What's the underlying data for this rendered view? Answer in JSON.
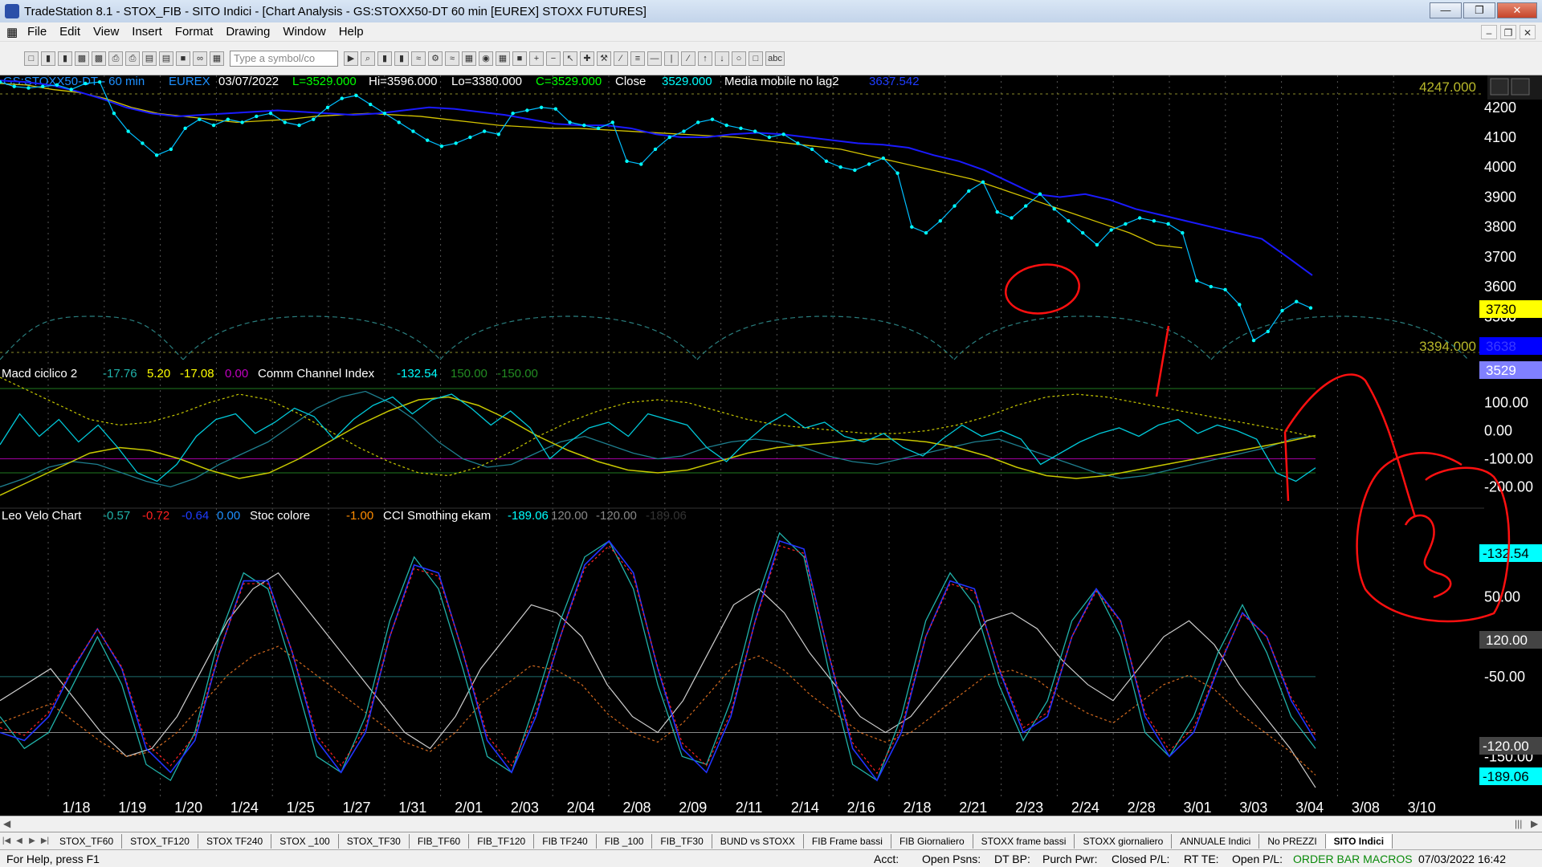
{
  "window": {
    "title": "TradeStation 8.1 - STOX_FIB - SITO Indici - [Chart Analysis - GS:STOXX50-DT  60 min  [EUREX] STOXX FUTURES]"
  },
  "menu": [
    "File",
    "Edit",
    "View",
    "Insert",
    "Format",
    "Drawing",
    "Window",
    "Help"
  ],
  "toolbar": {
    "symbol_placeholder": "Type a symbol/co"
  },
  "chart_header": {
    "symbol": "GS:STOXX50-DT - 60 min",
    "exchange": "EUREX",
    "date": "03/07/2022",
    "last": "L=3529.000",
    "hi": "Hi=3596.000",
    "lo": "Lo=3380.000",
    "close_field": "C=3529.000",
    "close_label": "Close",
    "close_value": "3529.000",
    "ma_label": "Media mobile no lag2",
    "ma_value": "3637.542"
  },
  "panel2_header": {
    "name1": "Macd ciclico 2",
    "v1": "-17.76",
    "v2": "5.20",
    "v3": "-17.08",
    "v4": "0.00",
    "name2": "Comm Channel Index",
    "v5": "-132.54",
    "v6": "150.00",
    "v7": "-150.00"
  },
  "panel3_header": {
    "name1": "Leo Velo Chart",
    "v1": "-0.57",
    "v2": "-0.72",
    "v3": "-0.64",
    "v4": "0.00",
    "name2": "Stoc colore",
    "v5": "-1.00",
    "name3": "CCI Smothing ekam",
    "v6": "-189.06",
    "v7": "120.00",
    "v8": "-120.00",
    "v9": "-189.06"
  },
  "price_levels": {
    "upper": "4247.000",
    "lower": "3394.000"
  },
  "axis_badges": {
    "yellow": "3730",
    "blue": "3638",
    "close": "3529",
    "cci": "-132.54",
    "stoch_top": "120.00",
    "stoch_mid": "-120.00",
    "cci_smooth": "-189.06"
  },
  "tabs": [
    "STOX_TF60",
    "STOX_TF120",
    "STOX TF240",
    "STOX _100",
    "STOX_TF30",
    "FIB_TF60",
    "FIB_TF120",
    "FIB TF240",
    "FIB _100",
    "FIB_TF30",
    "BUND vs STOXX",
    "FIB Frame bassi",
    "FIB Giornaliero",
    "STOXX frame bassi",
    "STOXX giornaliero",
    "ANNUALE Indici",
    "No PREZZI",
    "SITO Indici"
  ],
  "status": {
    "help": "For Help, press F1",
    "acct": "Acct:",
    "open_psns": "Open Psns:",
    "dt_bp": "DT BP:",
    "purch_pwr": "Purch Pwr:",
    "closed_pl": "Closed P/L:",
    "rt_te": "RT TE:",
    "open_pl": "Open P/L:",
    "macros": "ORDER BAR  MACROS",
    "datetime": "07/03/2022 16:42"
  },
  "chart_data": [
    {
      "type": "line",
      "panel": "price",
      "x_dates": [
        "1/18",
        "1/19",
        "1/20",
        "1/24",
        "1/25",
        "1/27",
        "1/31",
        "2/01",
        "2/03",
        "2/04",
        "2/08",
        "2/09",
        "2/11",
        "2/14",
        "2/16",
        "2/18",
        "2/21",
        "2/23",
        "2/24",
        "2/28",
        "3/01",
        "3/03",
        "3/04",
        "3/08",
        "3/10"
      ],
      "ylim": [
        3380,
        4280
      ],
      "y_ticks": [
        3500,
        3600,
        3700,
        3800,
        3900,
        4000,
        4100,
        4200
      ],
      "series": [
        {
          "values": [
            4285,
            4270,
            4265,
            4270,
            4275,
            4260,
            4280,
            4285,
            4180,
            4120,
            4080,
            4040,
            4060,
            4130,
            4160,
            4140,
            4160,
            4150,
            4170,
            4180,
            4150,
            4140,
            4160,
            4200,
            4230,
            4240,
            4210,
            4180,
            4150,
            4120,
            4090,
            4070,
            4080,
            4100,
            4120,
            4110,
            4180,
            4190,
            4200,
            4195,
            4150,
            4140,
            4130,
            4150,
            4020,
            4010,
            4060,
            4100,
            4120,
            4150,
            4160,
            4140,
            4130,
            4120,
            4100,
            4110,
            4080,
            4060,
            4020,
            4000,
            3990,
            4010,
            4030,
            3980,
            3800,
            3780,
            3820,
            3870,
            3920,
            3950,
            3850,
            3830,
            3870,
            3910,
            3860,
            3820,
            3780,
            3740,
            3790,
            3810,
            3830,
            3820,
            3810,
            3780,
            3620,
            3600,
            3590,
            3540,
            3420,
            3450,
            3520,
            3550,
            3529
          ]
        },
        {
          "values": [
            4280,
            4275,
            4260,
            4250,
            4230,
            4200,
            4180,
            4170,
            4160,
            4150,
            4155,
            4160,
            4170,
            4175,
            4180,
            4175,
            4170,
            4160,
            4150,
            4140,
            4135,
            4130,
            4130,
            4125,
            4120,
            4115,
            4110,
            4105,
            4100,
            4090,
            4080,
            4070,
            4060,
            4040,
            4020,
            4000,
            3980,
            3960,
            3930,
            3900,
            3870,
            3840,
            3810,
            3780,
            3740,
            3730
          ]
        },
        {
          "values": [
            4290,
            4285,
            4275,
            4255,
            4230,
            4200,
            4180,
            4170,
            4175,
            4180,
            4185,
            4190,
            4185,
            4180,
            4175,
            4180,
            4190,
            4200,
            4195,
            4185,
            4175,
            4160,
            4145,
            4140,
            4140,
            4130,
            4110,
            4100,
            4100,
            4110,
            4115,
            4110,
            4100,
            4090,
            4080,
            4075,
            4065,
            4040,
            4020,
            3990,
            3950,
            3910,
            3900,
            3910,
            3890,
            3860,
            3840,
            3820,
            3800,
            3780,
            3760,
            3700,
            3638
          ]
        }
      ]
    },
    {
      "type": "line",
      "panel": "macd_cci",
      "ylim": [
        -250,
        150
      ],
      "y_ticks": [
        100,
        0,
        -100,
        -200
      ],
      "y_tick_labels": [
        "100.00",
        "0.00",
        "-100.00",
        "-200.00"
      ],
      "series": [
        {
          "values": [
            -50,
            60,
            -20,
            40,
            -40,
            20,
            -60,
            -150,
            -180,
            -120,
            -20,
            40,
            60,
            -10,
            30,
            80,
            50,
            -30,
            40,
            90,
            120,
            60,
            110,
            130,
            80,
            20,
            70,
            10,
            -100,
            -40,
            10,
            30,
            -20,
            60,
            40,
            20,
            -60,
            -110,
            -40,
            20,
            60,
            10,
            30,
            -20,
            -40,
            -10,
            -60,
            -90,
            -30,
            20,
            -20,
            0,
            -30,
            -120,
            -80,
            -40,
            -10,
            10,
            -20,
            20,
            40,
            -10,
            20,
            0,
            -30,
            -150,
            -180,
            -132
          ]
        },
        {
          "values": [
            -200,
            -170,
            -130,
            -110,
            -120,
            -150,
            -180,
            -200,
            -170,
            -120,
            -80,
            -40,
            20,
            80,
            120,
            140,
            100,
            40,
            -40,
            -100,
            -130,
            -120,
            -80,
            -40,
            -20,
            -50,
            -80,
            -100,
            -90,
            -60,
            -40,
            -30,
            -40,
            -60,
            -90,
            -110,
            -120,
            -100,
            -80,
            -60,
            -40,
            -30,
            -60,
            -90,
            -120,
            -150,
            -170,
            -160,
            -140,
            -120,
            -100,
            -80,
            -60,
            -30,
            -17
          ]
        },
        {
          "values": [
            -230,
            -180,
            -130,
            -80,
            -60,
            -70,
            -100,
            -140,
            -170,
            -150,
            -100,
            -40,
            20,
            70,
            110,
            120,
            90,
            40,
            -20,
            -70,
            -110,
            -140,
            -150,
            -140,
            -110,
            -80,
            -60,
            -50,
            -40,
            -30,
            -30,
            -40,
            -60,
            -90,
            -130,
            -160,
            -170,
            -160,
            -140,
            -120,
            -100,
            -80,
            -60,
            -40,
            -17
          ]
        }
      ]
    },
    {
      "type": "line",
      "panel": "velo_stoc_cci",
      "ylim": [
        -200,
        140
      ],
      "y_ticks": [
        120,
        50,
        -50,
        -120,
        -150
      ],
      "y_tick_labels": [
        "120.00",
        "50.00",
        "-50.00",
        "-120.00",
        "-150.00"
      ],
      "series": [
        {
          "values": [
            -100,
            -140,
            -120,
            -60,
            0,
            -60,
            -160,
            -180,
            -120,
            0,
            80,
            60,
            -40,
            -150,
            -170,
            -100,
            20,
            100,
            60,
            -40,
            -150,
            -170,
            -80,
            20,
            100,
            120,
            60,
            -60,
            -150,
            -160,
            -80,
            40,
            130,
            100,
            -40,
            -160,
            -180,
            -100,
            20,
            80,
            40,
            -60,
            -130,
            -80,
            20,
            60,
            0,
            -120,
            -150,
            -100,
            -20,
            40,
            -20,
            -100,
            -140
          ]
        },
        {
          "values": [
            -120,
            -130,
            -100,
            -40,
            10,
            -40,
            -140,
            -170,
            -130,
            -20,
            70,
            70,
            -20,
            -130,
            -170,
            -120,
            0,
            90,
            80,
            -20,
            -130,
            -170,
            -100,
            0,
            90,
            120,
            80,
            -40,
            -140,
            -170,
            -100,
            20,
            120,
            110,
            -20,
            -140,
            -180,
            -120,
            0,
            70,
            60,
            -40,
            -120,
            -100,
            0,
            60,
            20,
            -100,
            -150,
            -120,
            -40,
            30,
            0,
            -80,
            -130
          ]
        },
        {
          "values": [
            -80,
            -60,
            -40,
            -80,
            -120,
            -150,
            -140,
            -100,
            -40,
            20,
            60,
            80,
            40,
            0,
            -40,
            -80,
            -120,
            -140,
            -100,
            -40,
            0,
            40,
            30,
            0,
            -60,
            -100,
            -120,
            -80,
            -20,
            40,
            60,
            30,
            -20,
            -60,
            -100,
            -120,
            -100,
            -60,
            -20,
            20,
            30,
            10,
            -30,
            -60,
            -80,
            -40,
            0,
            20,
            -10,
            -60,
            -100,
            -140,
            -189
          ]
        }
      ]
    }
  ]
}
